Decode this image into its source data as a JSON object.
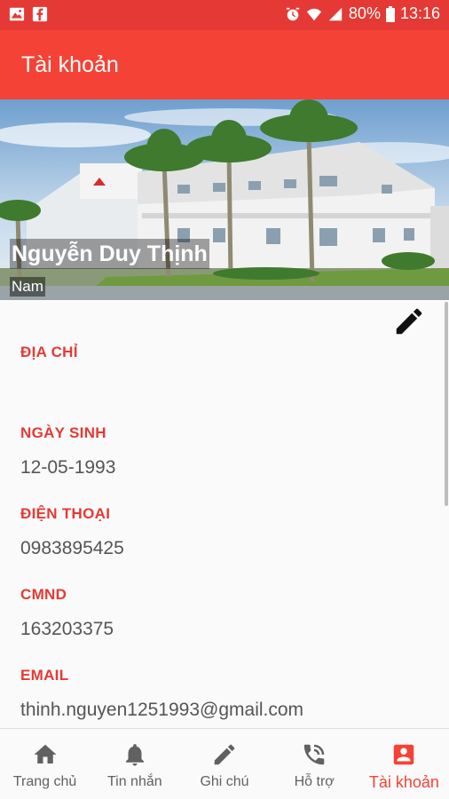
{
  "status_bar": {
    "battery": "80%",
    "time": "13:16",
    "icons": [
      "image-icon",
      "facebook-icon",
      "alarm-icon",
      "wifi-icon",
      "signal-icon",
      "battery-icon"
    ]
  },
  "app_bar": {
    "title": "Tài khoản"
  },
  "profile": {
    "name": "Nguyễn Duy Thịnh",
    "gender": "Nam"
  },
  "fields": [
    {
      "label": "ĐỊA CHỈ",
      "value": ""
    },
    {
      "label": "NGÀY SINH",
      "value": "12-05-1993"
    },
    {
      "label": "ĐIỆN THOẠI",
      "value": "0983895425"
    },
    {
      "label": "CMND",
      "value": "163203375"
    },
    {
      "label": "EMAIL",
      "value": "thinh.nguyen1251993@gmail.com"
    }
  ],
  "bottom_nav": [
    {
      "label": "Trang chủ",
      "icon": "home-icon"
    },
    {
      "label": "Tin nhắn",
      "icon": "bell-icon"
    },
    {
      "label": "Ghi chú",
      "icon": "pencil-icon"
    },
    {
      "label": "Hỗ trợ",
      "icon": "phone-icon"
    },
    {
      "label": "Tài khoản",
      "icon": "account-icon",
      "active": true
    }
  ],
  "colors": {
    "primary": "#f44336",
    "status_bar": "#e53935",
    "label": "#e53935",
    "value": "#555555"
  }
}
